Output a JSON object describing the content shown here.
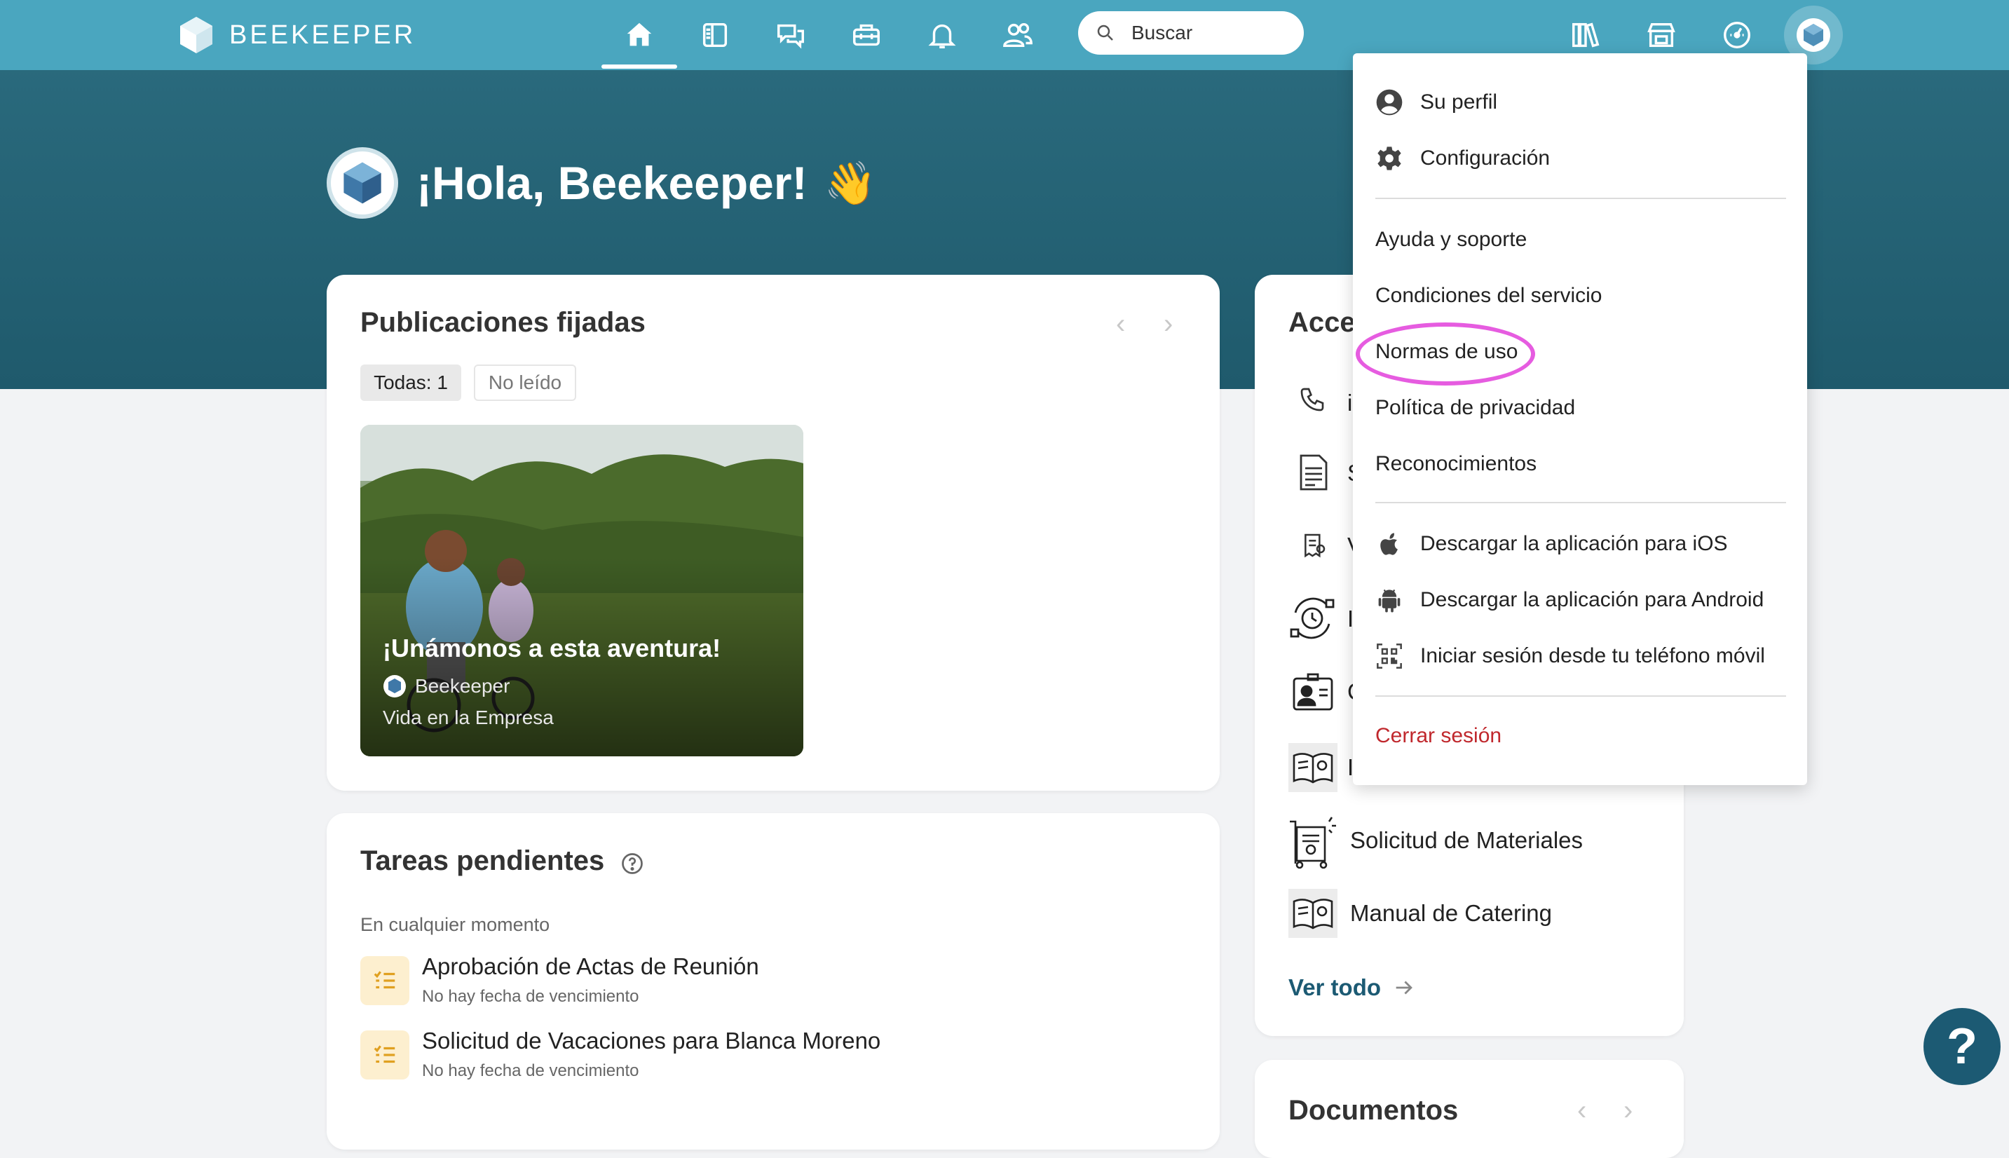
{
  "app": {
    "brand": "BEEKEEPER"
  },
  "nav": {
    "icons": [
      "home-icon",
      "news-feed-icon",
      "chat-icon",
      "toolbox-icon",
      "bell-icon",
      "people-icon"
    ],
    "search_placeholder": "Buscar",
    "right_icons": [
      "library-icon",
      "store-icon",
      "dashboard-icon"
    ]
  },
  "greeting": {
    "title": "¡Hola, Beekeeper!",
    "emoji": "👋"
  },
  "pinned": {
    "title": "Publicaciones fijadas",
    "filters": [
      "Todas: 1",
      "No leído"
    ],
    "post": {
      "title": "¡Unámonos a esta aventura!",
      "author": "Beekeeper",
      "category": "Vida en la Empresa"
    }
  },
  "tasks": {
    "title": "Tareas pendientes",
    "group": "En cualquier momento",
    "items": [
      {
        "title": "Aprobación de Actas de Reunión",
        "due": "No hay fecha de vencimiento"
      },
      {
        "title": "Solicitud de Vacaciones para Blanca Moreno",
        "due": "No hay fecha de vencimiento"
      }
    ]
  },
  "access": {
    "title": "Acce",
    "partial_labels": [
      "i",
      "S",
      "V",
      "I",
      "C",
      "I"
    ],
    "items": [
      {
        "label": "Solicitud de Materiales",
        "icon": "materials-request-icon"
      },
      {
        "label": "Manual de Catering",
        "icon": "catering-manual-icon"
      }
    ],
    "see_all": "Ver todo"
  },
  "documents": {
    "title": "Documentos"
  },
  "menu": {
    "profile": "Su perfil",
    "settings": "Configuración",
    "help": "Ayuda y soporte",
    "terms": "Condiciones del servicio",
    "rules": "Normas de uso",
    "privacy": "Política de privacidad",
    "credits": "Reconocimientos",
    "ios": "Descargar la aplicación para iOS",
    "android": "Descargar la aplicación para Android",
    "mobile_login": "Iniciar sesión desde tu teléfono móvil",
    "logout": "Cerrar sesión"
  },
  "help_button": "?",
  "colors": {
    "topbar": "#4aa6bf",
    "hero": "#2c6d80",
    "accent": "#1c5a73",
    "logout": "#c0282d",
    "highlight": "#e65ce0"
  }
}
